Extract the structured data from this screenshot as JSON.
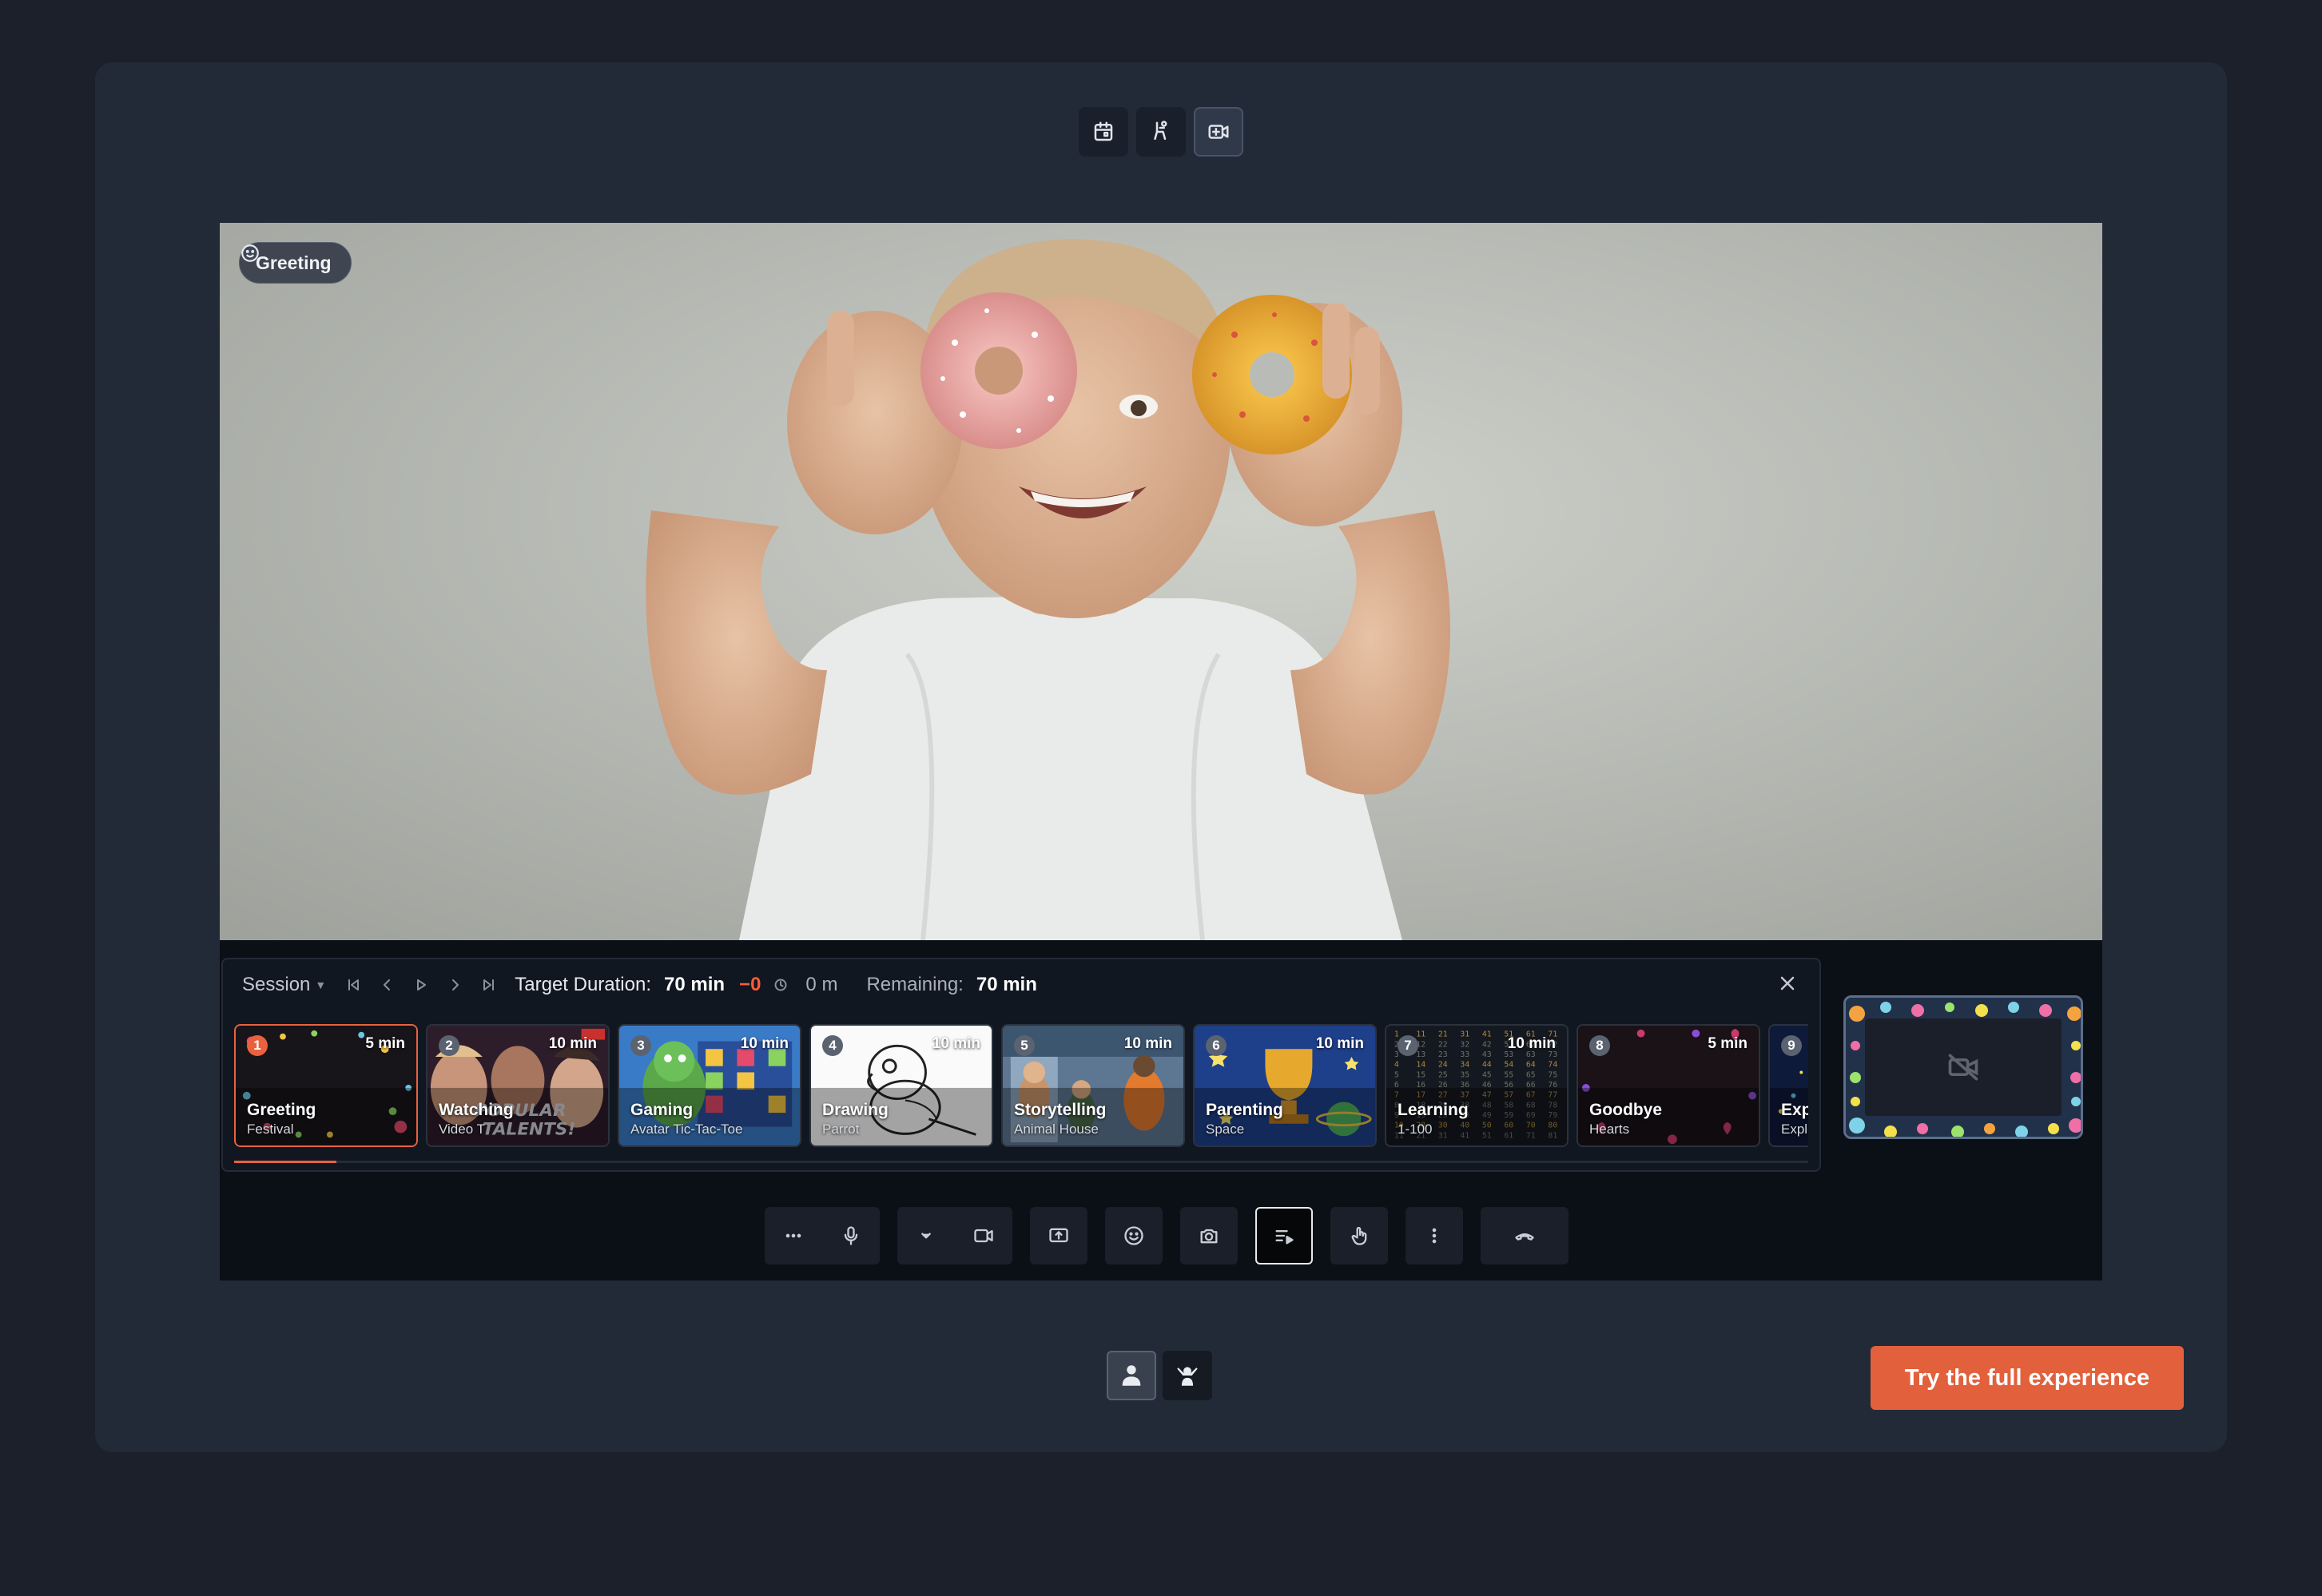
{
  "top_modes": [
    {
      "name": "calendar-icon",
      "active": false
    },
    {
      "name": "seated-person-icon",
      "active": false
    },
    {
      "name": "video-add-icon",
      "active": true
    }
  ],
  "video": {
    "chip_label": "Greeting"
  },
  "session": {
    "label": "Session",
    "target_label": "Target Duration:",
    "target_value": "70 min",
    "delta": "−0",
    "elapsed": "0 m",
    "remaining_label": "Remaining:",
    "remaining_value": "70 min",
    "progress": 0.065,
    "activities": [
      {
        "num": "1",
        "duration": "5 min",
        "title": "Greeting",
        "subtitle": "Festival",
        "active": true
      },
      {
        "num": "2",
        "duration": "10 min",
        "title": "Watching",
        "subtitle": "Video T",
        "active": false
      },
      {
        "num": "3",
        "duration": "10 min",
        "title": "Gaming",
        "subtitle": "Avatar Tic-Tac-Toe",
        "active": false
      },
      {
        "num": "4",
        "duration": "10 min",
        "title": "Drawing",
        "subtitle": "Parrot",
        "active": false
      },
      {
        "num": "5",
        "duration": "10 min",
        "title": "Storytelling",
        "subtitle": "Animal House",
        "active": false
      },
      {
        "num": "6",
        "duration": "10 min",
        "title": "Parenting",
        "subtitle": "Space",
        "active": false
      },
      {
        "num": "7",
        "duration": "10 min",
        "title": "Learning",
        "subtitle": "1-100",
        "active": false
      },
      {
        "num": "8",
        "duration": "5 min",
        "title": "Goodbye",
        "subtitle": "Hearts",
        "active": false
      },
      {
        "num": "9",
        "duration": "",
        "title": "Explo",
        "subtitle": "Explor",
        "active": false
      }
    ]
  },
  "colors": {
    "accent": "#e2603c",
    "panel": "#222a37",
    "background": "#1b202b"
  },
  "cta": {
    "label": "Try the full experience"
  }
}
